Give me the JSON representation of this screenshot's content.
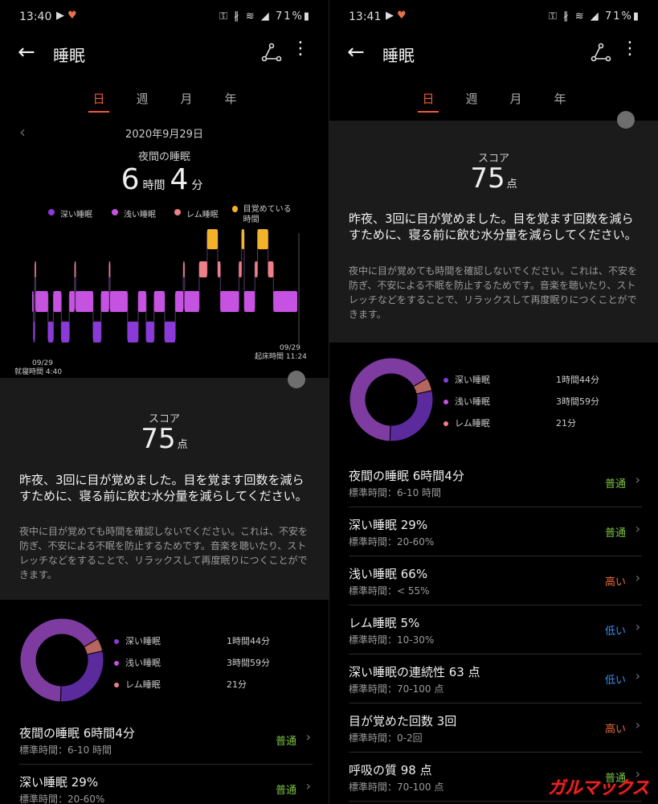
{
  "colors": {
    "deep": "#8a3ad8",
    "light": "#c552e0",
    "rem": "#ee7e88",
    "awake": "#f2b32a",
    "normal": "#7bc143",
    "high": "#ee6c3a",
    "low": "#3a8ee8",
    "accent": "#f25a3c"
  },
  "left": {
    "status": {
      "time": "13:40",
      "battery": "71%"
    },
    "appbar": {
      "title": "睡眠"
    },
    "tabs": [
      "日",
      "週",
      "月",
      "年"
    ],
    "date": "2020年9月29日",
    "night_label": "夜間の睡眠",
    "total": {
      "hours": "6",
      "h_unit": "時間",
      "minutes": "4",
      "m_unit": "分"
    },
    "legend": {
      "deep": "深い睡眠",
      "light": "浅い睡眠",
      "rem": "レム睡眠",
      "awake": "目覚めている時間"
    },
    "bed": {
      "date": "09/29",
      "label": "就寝時間 4:40"
    },
    "wake": {
      "date": "09/29",
      "label": "起床時間 11:24"
    },
    "score": {
      "label": "スコア",
      "value": "75",
      "unit": "点"
    },
    "advice": "昨夜、3回に目が覚めました。目を覚ます回数を減らすために、寝る前に飲む水分量を減らしてください。",
    "tip": "夜中に目が覚めても時間を確認しないでください。これは、不安を防ぎ、不安による不眠を防止するためです。音楽を聴いたり、ストレッチなどをすることで、リラックスして再度眠りにつくことができます。",
    "dist": [
      {
        "label": "深い睡眠",
        "value": "1時間44分"
      },
      {
        "label": "浅い睡眠",
        "value": "3時間59分"
      },
      {
        "label": "レム睡眠",
        "value": "21分"
      }
    ],
    "metrics": [
      {
        "title": "夜間の睡眠  6時間4分",
        "std": "標準時間：6-10 時間",
        "status": "普通"
      },
      {
        "title": "深い睡眠  29%",
        "std": "標準時間：20-60%",
        "status": "普通"
      }
    ]
  },
  "right": {
    "status": {
      "time": "13:41",
      "battery": "71%"
    },
    "appbar": {
      "title": "睡眠"
    },
    "tabs": [
      "日",
      "週",
      "月",
      "年"
    ],
    "score": {
      "label": "スコア",
      "value": "75",
      "unit": "点"
    },
    "advice": "昨夜、3回に目が覚めました。目を覚ます回数を減らすために、寝る前に飲む水分量を減らしてください。",
    "tip": "夜中に目が覚めても時間を確認しないでください。これは、不安を防ぎ、不安による不眠を防止するためです。音楽を聴いたり、ストレッチなどをすることで、リラックスして再度眠りにつくことができます。",
    "dist": [
      {
        "label": "深い睡眠",
        "value": "1時間44分"
      },
      {
        "label": "浅い睡眠",
        "value": "3時間59分"
      },
      {
        "label": "レム睡眠",
        "value": "21分"
      }
    ],
    "metrics": [
      {
        "title": "夜間の睡眠  6時間4分",
        "std": "標準時間：6-10 時間",
        "status": "普通",
        "level": "normal"
      },
      {
        "title": "深い睡眠  29%",
        "std": "標準時間：20-60%",
        "status": "普通",
        "level": "normal"
      },
      {
        "title": "浅い睡眠  66%",
        "std": "標準時間：< 55%",
        "status": "高い",
        "level": "high"
      },
      {
        "title": "レム睡眠  5%",
        "std": "標準時間：10-30%",
        "status": "低い",
        "level": "low"
      },
      {
        "title": "深い睡眠の連続性  63 点",
        "std": "標準時間：70-100 点",
        "status": "低い",
        "level": "low"
      },
      {
        "title": "目が覚めた回数  3回",
        "std": "標準時間：0-2回",
        "status": "高い",
        "level": "high"
      },
      {
        "title": "呼吸の質  98 点",
        "std": "標準時間：70-100 点",
        "status": "普通",
        "level": "normal"
      }
    ]
  },
  "watermark": "ガルマックス",
  "chart_data": {
    "type": "hypnogram",
    "stages": [
      "awake",
      "rem",
      "light",
      "deep"
    ],
    "segments": [
      [
        "light",
        0,
        0.5
      ],
      [
        "deep",
        0.5,
        1
      ],
      [
        "rem",
        1,
        1.3
      ],
      [
        "light",
        1.3,
        6
      ],
      [
        "deep",
        6,
        8
      ],
      [
        "light",
        8,
        11
      ],
      [
        "deep",
        11,
        14
      ],
      [
        "light",
        14,
        16
      ],
      [
        "rem",
        16,
        16.4
      ],
      [
        "light",
        16.4,
        23
      ],
      [
        "deep",
        23,
        26
      ],
      [
        "light",
        26,
        29
      ],
      [
        "rem",
        29,
        29.4
      ],
      [
        "light",
        29.4,
        36
      ],
      [
        "deep",
        36,
        40
      ],
      [
        "light",
        40,
        43
      ],
      [
        "deep",
        43,
        46
      ],
      [
        "light",
        46,
        50
      ],
      [
        "deep",
        50,
        54
      ],
      [
        "light",
        54,
        57
      ],
      [
        "rem",
        57,
        57.5
      ],
      [
        "light",
        57.5,
        63
      ],
      [
        "rem",
        63,
        66
      ],
      [
        "awake",
        66,
        70
      ],
      [
        "rem",
        70,
        71
      ],
      [
        "light",
        71,
        78
      ],
      [
        "rem",
        78,
        79
      ],
      [
        "awake",
        79,
        80
      ],
      [
        "light",
        80,
        84
      ],
      [
        "rem",
        84,
        85
      ],
      [
        "awake",
        85,
        89
      ],
      [
        "rem",
        89,
        91
      ],
      [
        "light",
        91,
        100
      ]
    ],
    "donut": {
      "deep": 29,
      "light": 66,
      "rem": 5
    }
  }
}
